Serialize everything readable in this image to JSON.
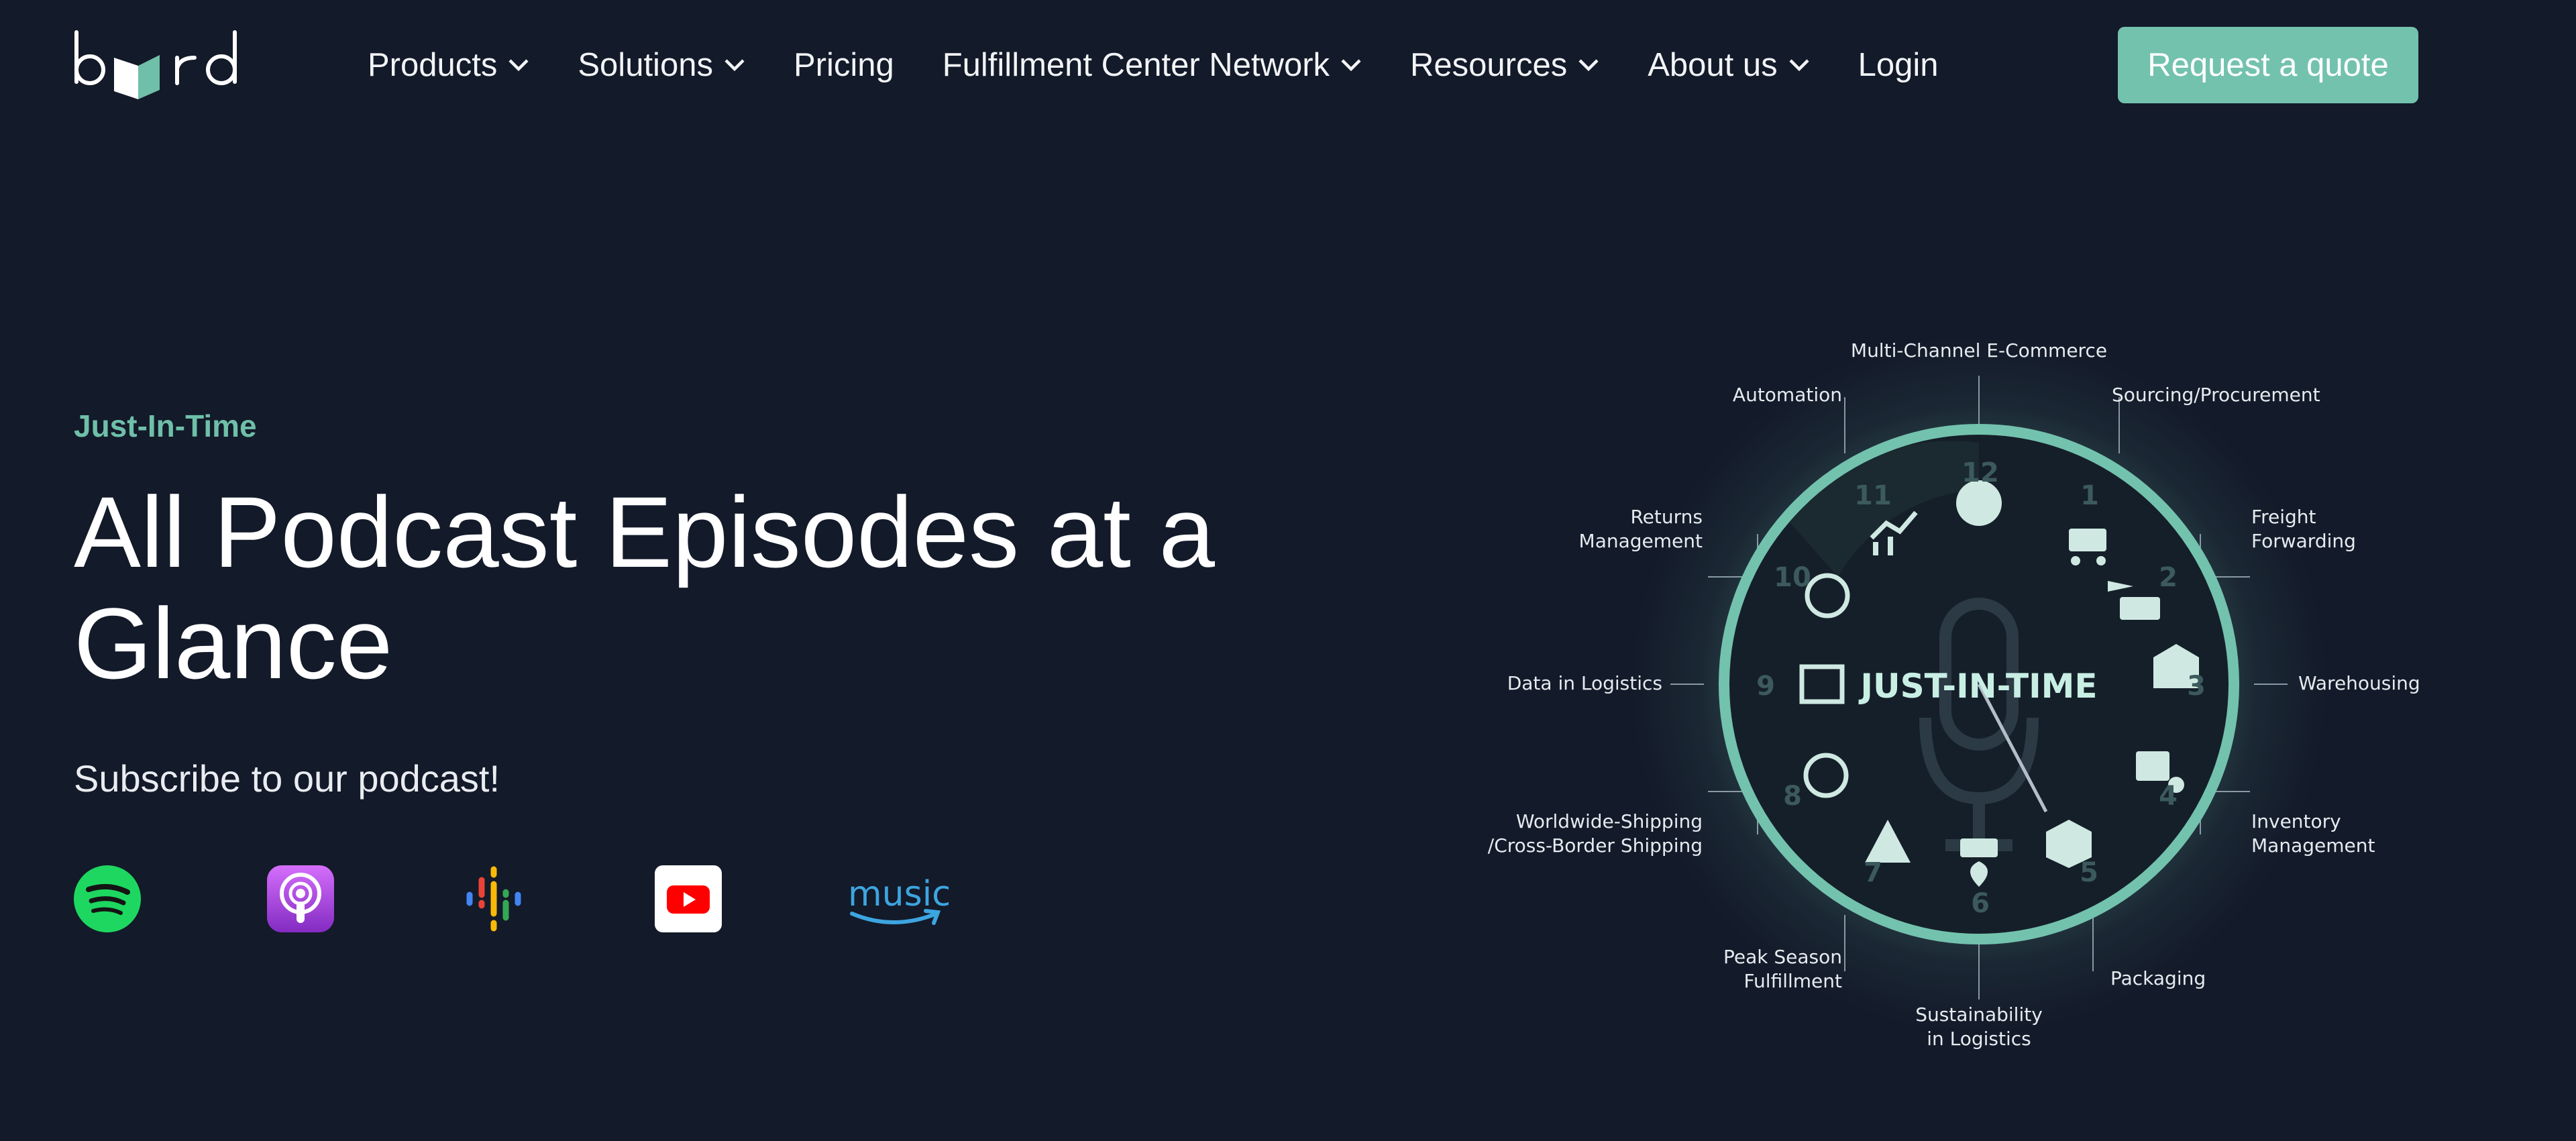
{
  "brand": {
    "logo_text": "byrd",
    "accent_color": "#73c2ae"
  },
  "nav": {
    "items": [
      {
        "label": "Products",
        "has_dropdown": true
      },
      {
        "label": "Solutions",
        "has_dropdown": true
      },
      {
        "label": "Pricing",
        "has_dropdown": false
      },
      {
        "label": "Fulfillment Center Network",
        "has_dropdown": true
      },
      {
        "label": "Resources",
        "has_dropdown": true
      },
      {
        "label": "About us",
        "has_dropdown": true
      },
      {
        "label": "Login",
        "has_dropdown": false
      }
    ],
    "cta_label": "Request a quote"
  },
  "hero": {
    "eyebrow": "Just-In-Time",
    "title": "All Podcast Episodes at a Glance",
    "subscribe_text": "Subscribe to our podcast!",
    "platforms": [
      {
        "icon": "spotify-icon",
        "color": "#1ed760"
      },
      {
        "icon": "apple-podcasts-icon",
        "color": "#a34bd8"
      },
      {
        "icon": "google-podcasts-icon",
        "color": "#4285f4"
      },
      {
        "icon": "youtube-icon",
        "color": "#ff0000"
      },
      {
        "icon": "amazon-music-icon",
        "color": "#3da5e0",
        "text": "music"
      }
    ]
  },
  "diagram": {
    "center_title": "JUST-IN-TIME",
    "segments": [
      {
        "num": "12",
        "label": "Multi-Channel E-Commerce"
      },
      {
        "num": "1",
        "label": "Sourcing/Procurement"
      },
      {
        "num": "2",
        "label_lines": [
          "Freight",
          "Forwarding"
        ]
      },
      {
        "num": "3",
        "label": "Warehousing"
      },
      {
        "num": "4",
        "label_lines": [
          "Inventory",
          "Management"
        ]
      },
      {
        "num": "5",
        "label": "Packaging"
      },
      {
        "num": "6",
        "label_lines": [
          "Sustainability",
          "in Logistics"
        ]
      },
      {
        "num": "7",
        "label_lines": [
          "Peak Season",
          "Fulfillment"
        ]
      },
      {
        "num": "8",
        "label_lines": [
          "Worldwide-Shipping",
          "/Cross-Border Shipping"
        ]
      },
      {
        "num": "9",
        "label": "Data in Logistics"
      },
      {
        "num": "10",
        "label_lines": [
          "Returns",
          "Management"
        ]
      },
      {
        "num": "11",
        "label": "Automation"
      }
    ]
  }
}
